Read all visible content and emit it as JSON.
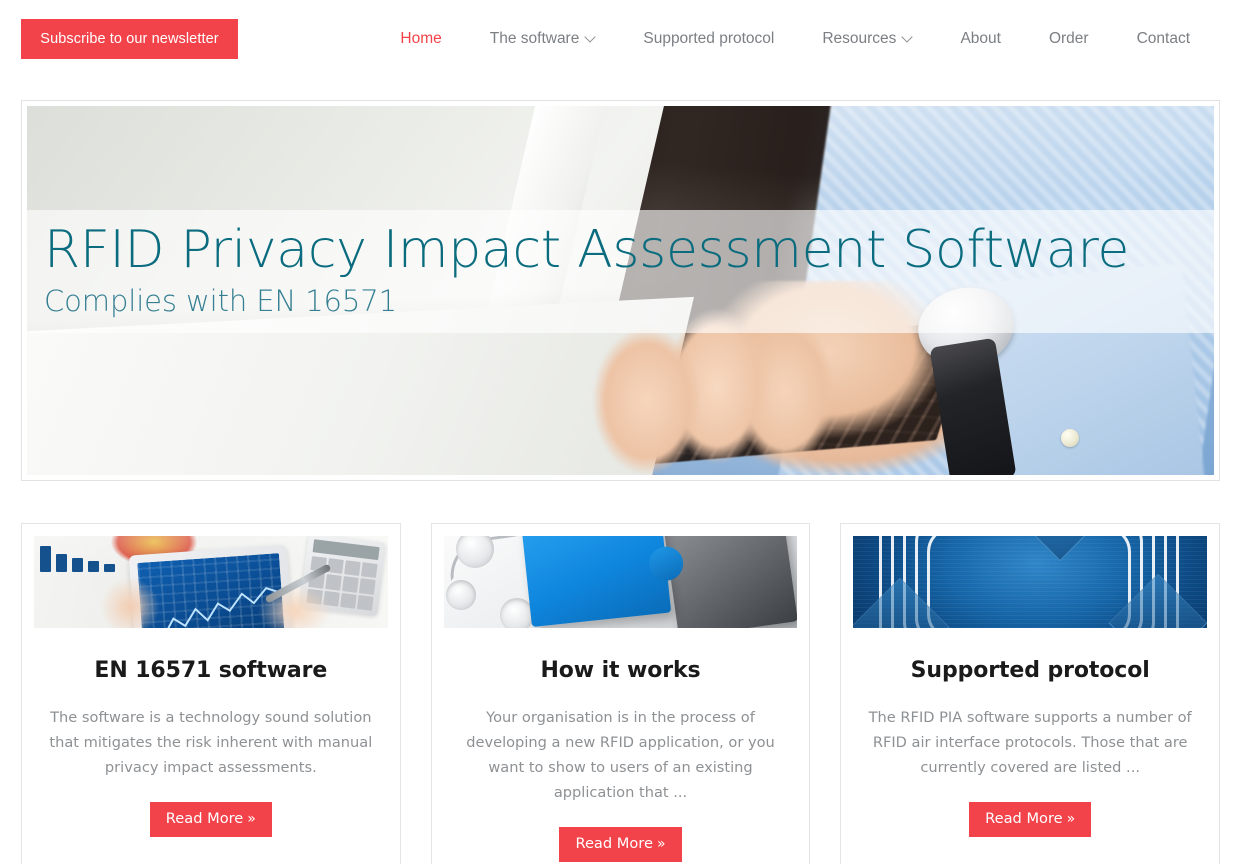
{
  "header": {
    "subscribe_label": "Subscribe to our newsletter",
    "nav": [
      {
        "label": "Home",
        "active": true,
        "has_dropdown": false
      },
      {
        "label": "The software",
        "active": false,
        "has_dropdown": true
      },
      {
        "label": "Supported protocol",
        "active": false,
        "has_dropdown": false
      },
      {
        "label": "Resources",
        "active": false,
        "has_dropdown": true
      },
      {
        "label": "About",
        "active": false,
        "has_dropdown": false
      },
      {
        "label": "Order",
        "active": false,
        "has_dropdown": false
      },
      {
        "label": "Contact",
        "active": false,
        "has_dropdown": false
      }
    ]
  },
  "hero": {
    "title": "RFID Privacy Impact Assessment Software",
    "subtitle": "Complies with EN 16571",
    "image_alt": "hands typing on a laptop keyboard"
  },
  "cards": [
    {
      "title": "EN 16571 software",
      "text": "The software is a technology sound solution that mitigates the risk inherent with manual privacy impact assessments.",
      "cta": "Read More",
      "cta_arrows": "»",
      "image_alt": "tablet showing a blue financial chart with calculator"
    },
    {
      "title": "How it works",
      "text": "Your organisation is in the process of developing a new RFID application, or you want to show to users of an existing application that ...",
      "cta": "Read More",
      "cta_arrows": "»",
      "image_alt": "blue and grey jigsaw puzzle pieces"
    },
    {
      "title": "Supported protocol",
      "text": "The RFID PIA software supports a number of RFID air interface protocols. Those that are currently covered are listed ...",
      "cta": "Read More",
      "cta_arrows": "»",
      "image_alt": "blue RFID tag antenna coil"
    }
  ],
  "colors": {
    "accent_red": "#f2434a",
    "hero_title_teal": "#0a6c7e",
    "hero_subtitle_teal": "#357f92",
    "nav_text": "#7b7f83",
    "body_text": "#8e9194",
    "heading_text": "#1a1a1a",
    "border": "#e4e4e4"
  }
}
